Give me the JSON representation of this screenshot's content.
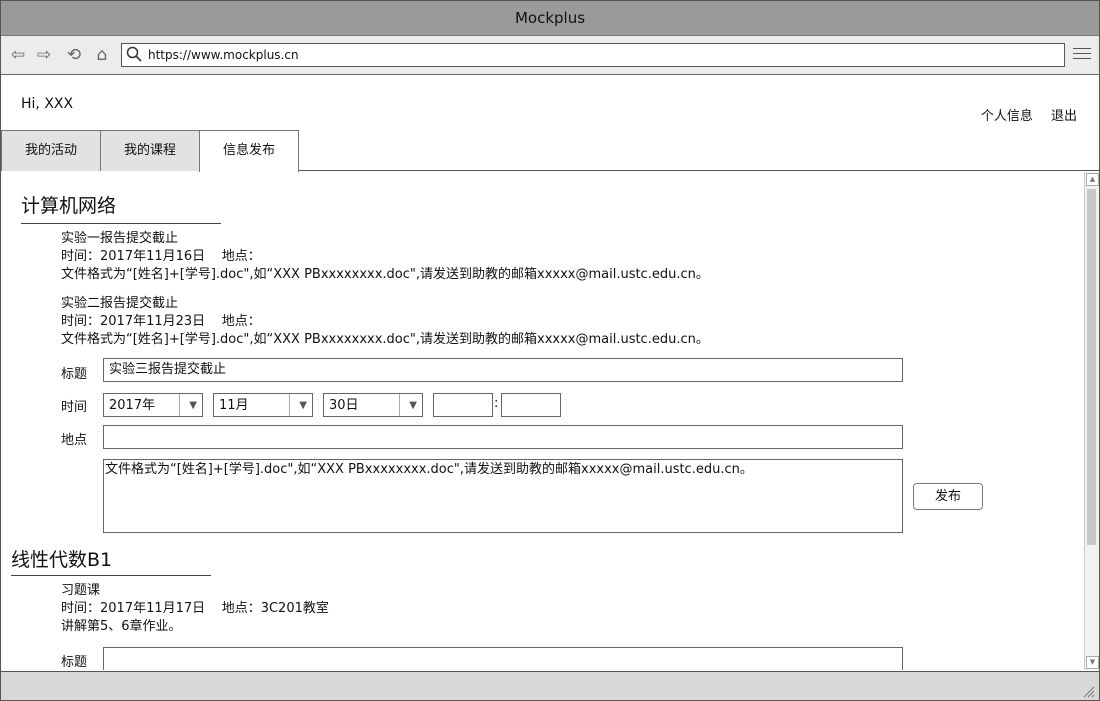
{
  "window": {
    "title": "Mockplus"
  },
  "browser": {
    "url": "https://www.mockplus.cn",
    "icons": [
      "back-icon",
      "forward-icon",
      "refresh-icon",
      "home-icon",
      "search-icon",
      "menu-icon"
    ]
  },
  "header": {
    "greeting": "Hi, XXX",
    "links": {
      "profile": "个人信息",
      "logout": "退出"
    }
  },
  "tabs": [
    {
      "label": "我的活动",
      "active": false
    },
    {
      "label": "我的课程",
      "active": false
    },
    {
      "label": "信息发布",
      "active": true
    }
  ],
  "sections": [
    {
      "title": "计算机网络",
      "notices": [
        {
          "title": "实验一报告提交截止",
          "time_line": "时间：2017年11月16日",
          "place_line": "地点：",
          "desc": "文件格式为“[姓名]+[学号].doc\",如“XXX PBxxxxxxxx.doc\",请发送到助教的邮箱xxxxx@mail.ustc.edu.cn。"
        },
        {
          "title": "实验二报告提交截止",
          "time_line": "时间：2017年11月23日",
          "place_line": "地点：",
          "desc": "文件格式为“[姓名]+[学号].doc\",如“XXX PBxxxxxxxx.doc\",请发送到助教的邮箱xxxxx@mail.ustc.edu.cn。"
        }
      ],
      "form": {
        "title_label": "标题",
        "title_value": "实验三报告提交截止",
        "time_label": "时间",
        "year": "2017年",
        "month": "11月",
        "day": "30日",
        "hour": "",
        "minute": "",
        "colon": ":",
        "place_label": "地点",
        "place_value": "",
        "desc_value": "文件格式为“[姓名]+[学号].doc\",如“XXX PBxxxxxxxx.doc\",请发送到助教的邮箱xxxxx@mail.ustc.edu.cn。",
        "publish_label": "发布"
      }
    },
    {
      "title": "线性代数B1",
      "notices": [
        {
          "title": "习题课",
          "time_line": "时间：2017年11月17日",
          "place_line": "地点：3C201教室",
          "desc": "讲解第5、6章作业。"
        }
      ],
      "form": {
        "title_label": "标题",
        "title_value": ""
      }
    }
  ]
}
